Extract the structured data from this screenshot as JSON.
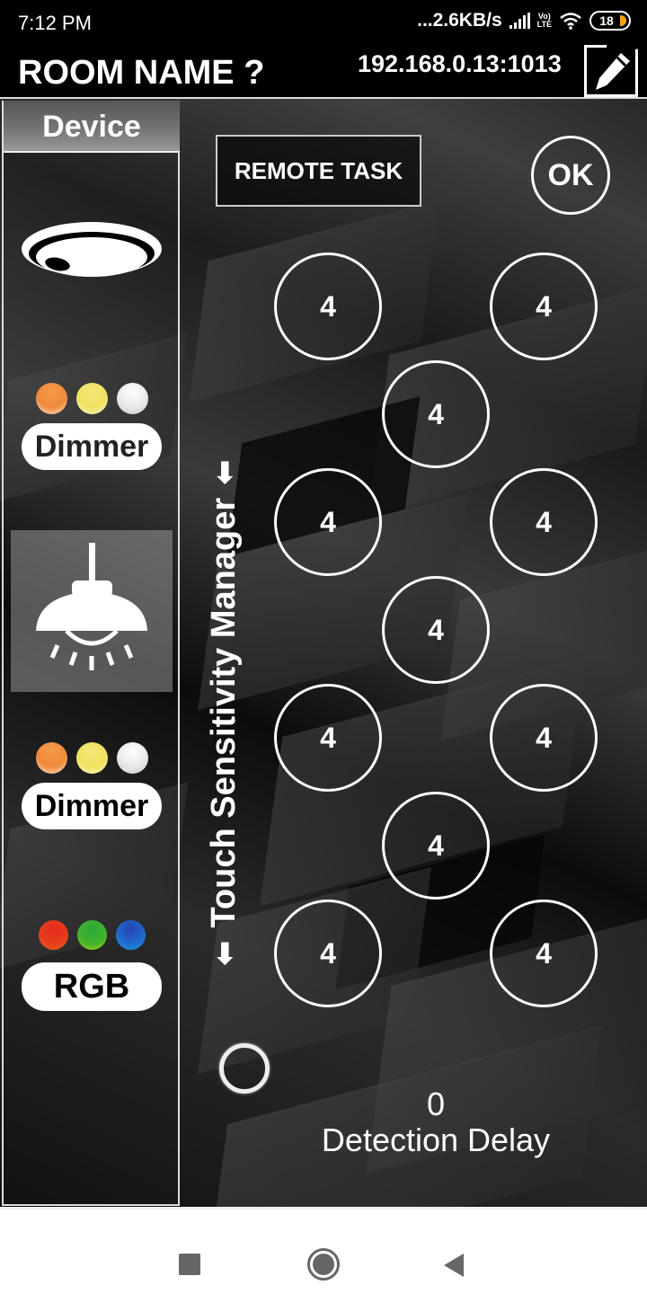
{
  "status_bar": {
    "time": "7:12 PM",
    "net_speed": "...2.6KB/s",
    "volte_top": "Vo)",
    "volte_bottom": "LTE",
    "battery": "18",
    "icons": [
      "signal-icon",
      "volte-icon",
      "wifi-icon",
      "battery-icon"
    ]
  },
  "header": {
    "room_name": "ROOM NAME ?",
    "ip_address": "192.168.0.13:1013",
    "edit_icon": "pencil-icon"
  },
  "sidebar": {
    "title": "Device",
    "items": [
      {
        "type": "smoke-detector",
        "icon": "ceiling-sensor-icon",
        "selected": false
      },
      {
        "type": "dimmer",
        "label": "Dimmer",
        "dot_colors": [
          "#f08a3a",
          "#f1e46a",
          "#dedede"
        ],
        "selected": false
      },
      {
        "type": "pendant-light",
        "icon": "pendant-lamp-icon",
        "selected": true
      },
      {
        "type": "dimmer",
        "label": "Dimmer",
        "dot_colors": [
          "#f08a3a",
          "#f1e46a",
          "#dedede"
        ],
        "selected": false
      },
      {
        "type": "rgb",
        "label": "RGB",
        "dot_colors": [
          "#e5301c",
          "#43b52a",
          "#1e6fd0"
        ],
        "selected": false
      }
    ]
  },
  "vertical_label": {
    "text": "Touch Sensitivity Manager",
    "arrow": "⬅"
  },
  "main": {
    "remote_task_label": "REMOTE TASK",
    "ok_label": "OK",
    "sensors": [
      "4",
      "4",
      "4",
      "4",
      "4",
      "4",
      "4",
      "4",
      "4",
      "4",
      "4"
    ],
    "detection_delay_value": "0",
    "detection_delay_label": "Detection Delay"
  },
  "nav_bar": {
    "recents": "recents-icon",
    "home": "home-icon",
    "back": "back-icon"
  }
}
